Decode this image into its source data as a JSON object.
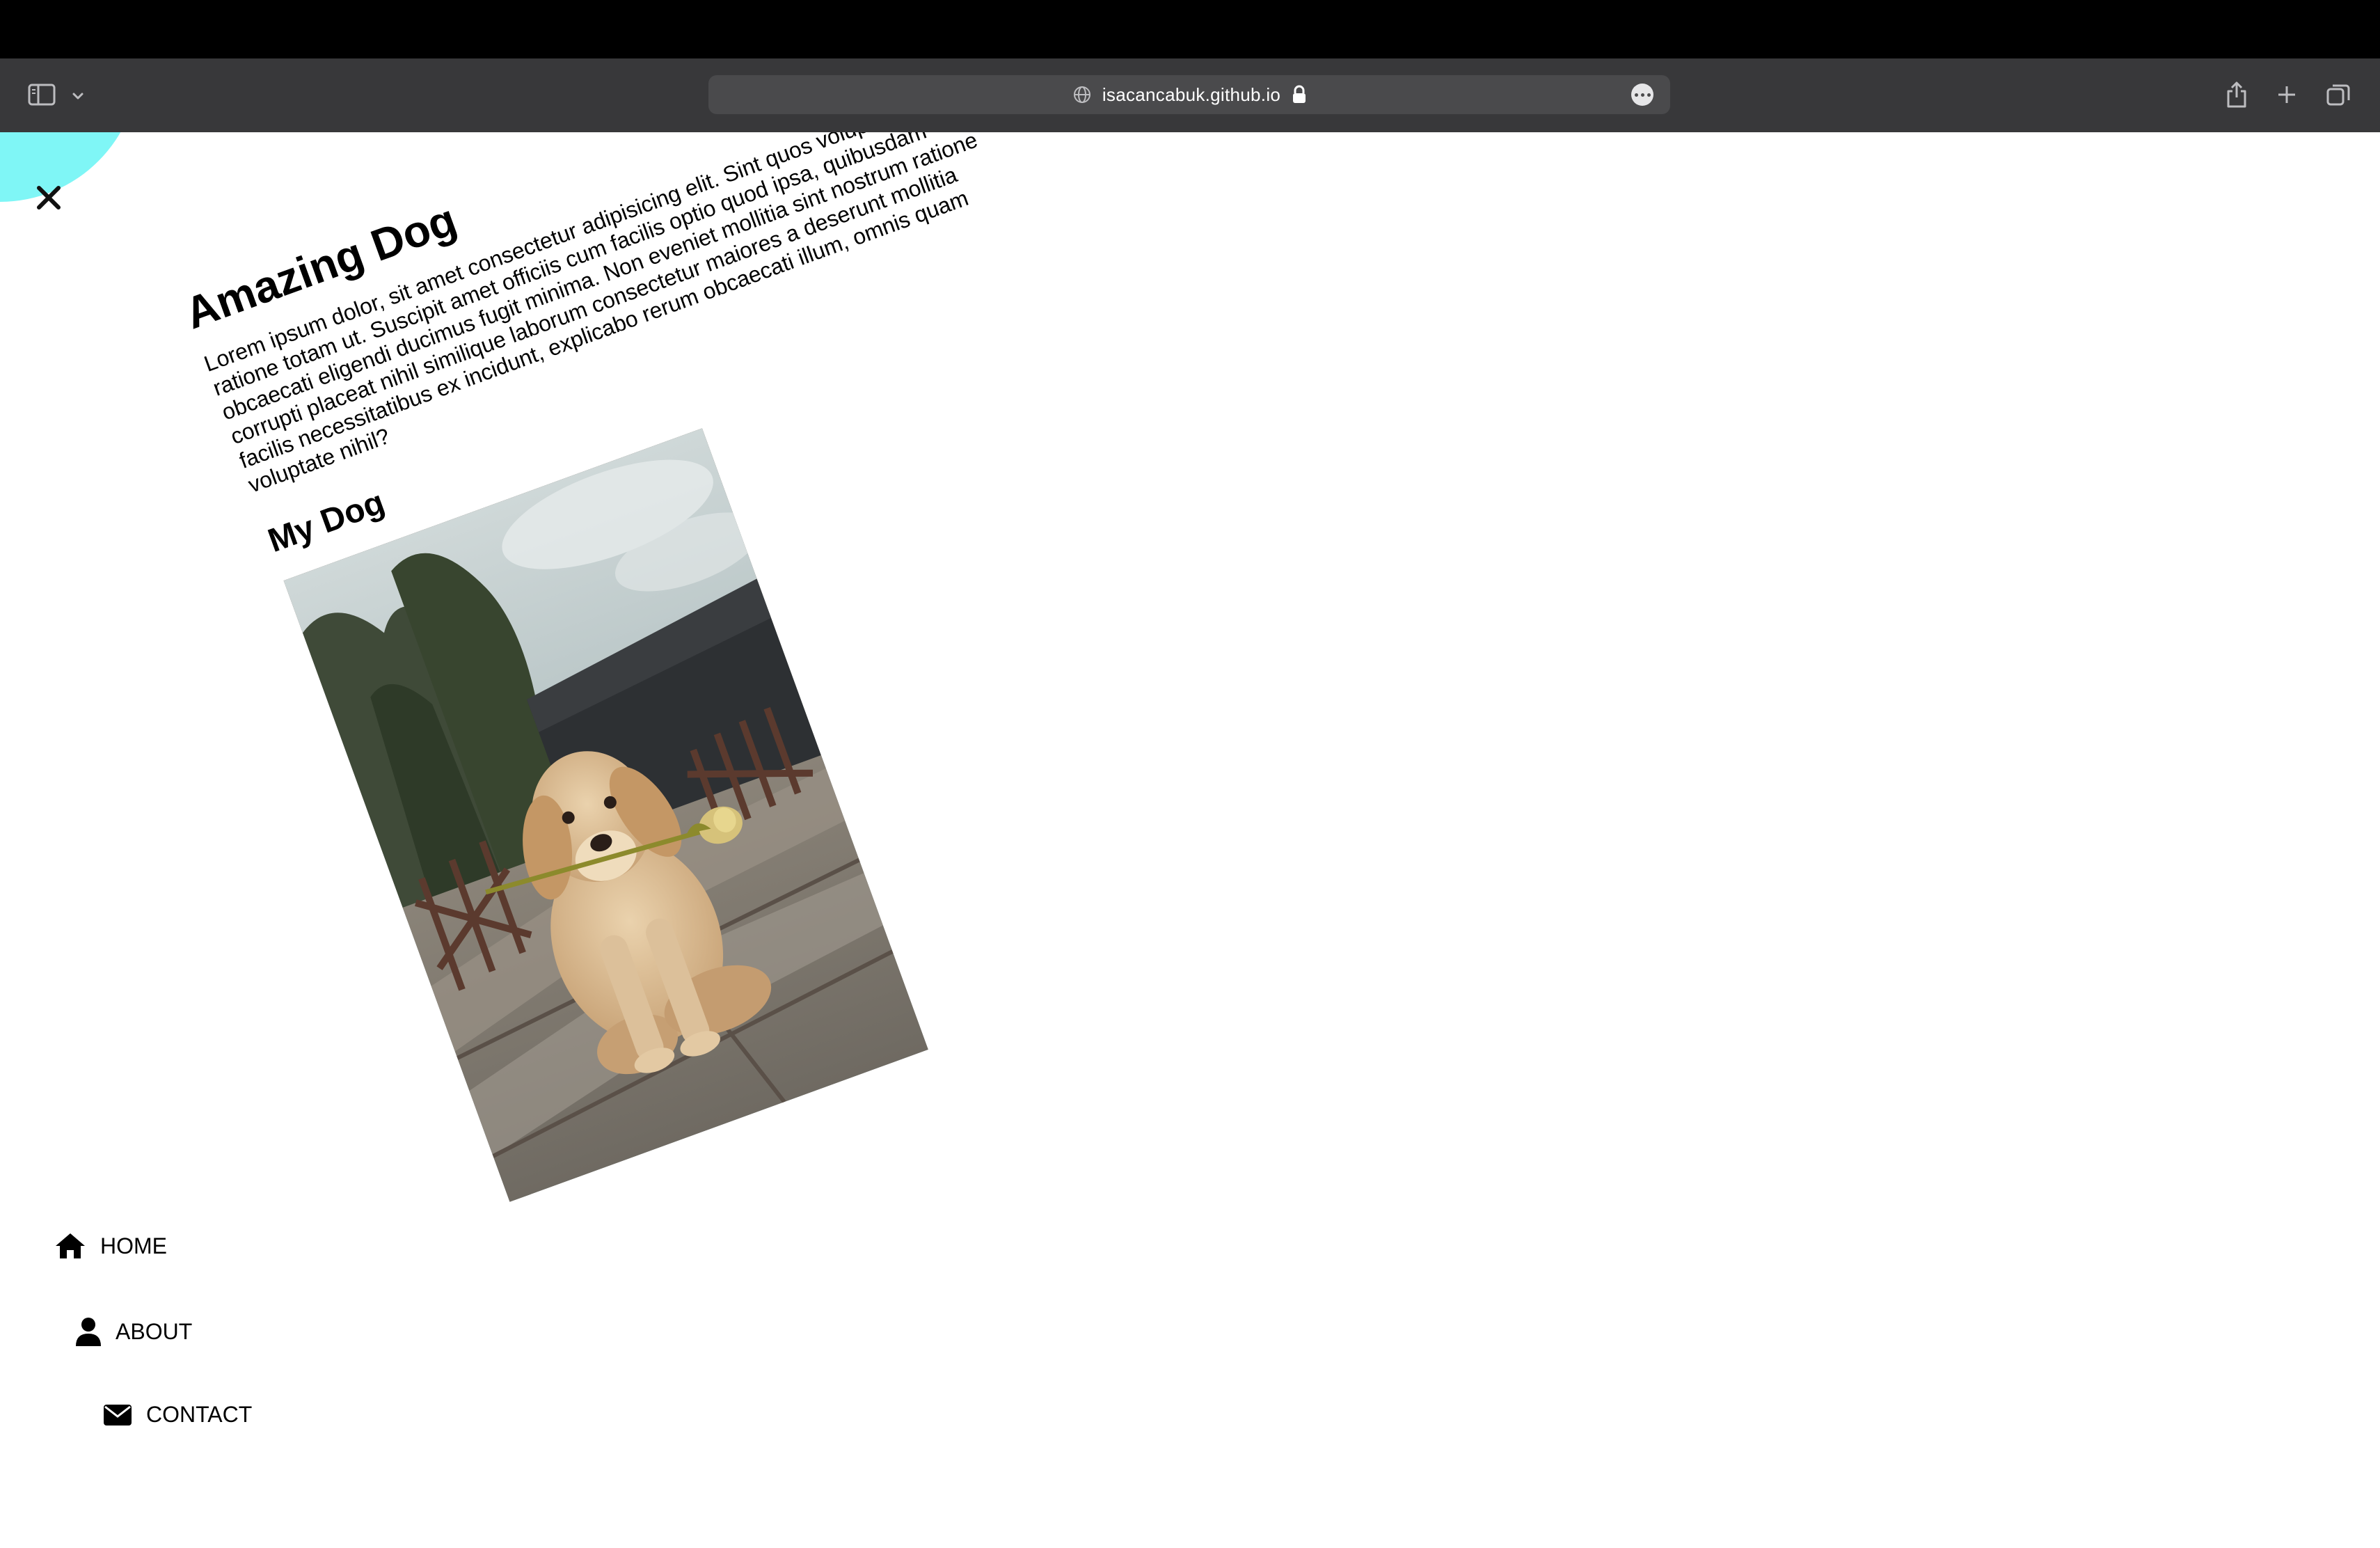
{
  "browser": {
    "url": "isacancabuk.github.io",
    "icons": {
      "sidebar": "sidebar-icon",
      "chevron": "chevron-down-icon",
      "globe": "globe-icon",
      "lock": "lock-icon",
      "more": "ellipsis-icon",
      "share": "share-icon",
      "new_tab": "plus-icon",
      "tabs": "tabs-overview-icon"
    }
  },
  "page": {
    "menu_close_icon": "close-icon",
    "accent_color": "#7ff6f6",
    "title": "Amazing Dog",
    "body": "Lorem ipsum dolor, sit amet consectetur adipisicing elit. Sint quos voluptatum ratione totam ut. Suscipit amet officiis cum facilis optio quod ipsa, quibusdam obcaecati eligendi ducimus fugit minima. Non eveniet mollitia sint nostrum ratione corrupti placeat nihil similique laborum consectetur maiores a deserunt mollitia facilis necessitatibus ex incidunt, explicabo rerum obcaecati illum, omnis quam voluptate nihil?",
    "subtitle": "My Dog"
  },
  "nav": {
    "home": {
      "label": "HOME",
      "icon": "home-icon"
    },
    "about": {
      "label": "ABOUT",
      "icon": "user-icon"
    },
    "contact": {
      "label": "CONTACT",
      "icon": "envelope-icon"
    }
  }
}
